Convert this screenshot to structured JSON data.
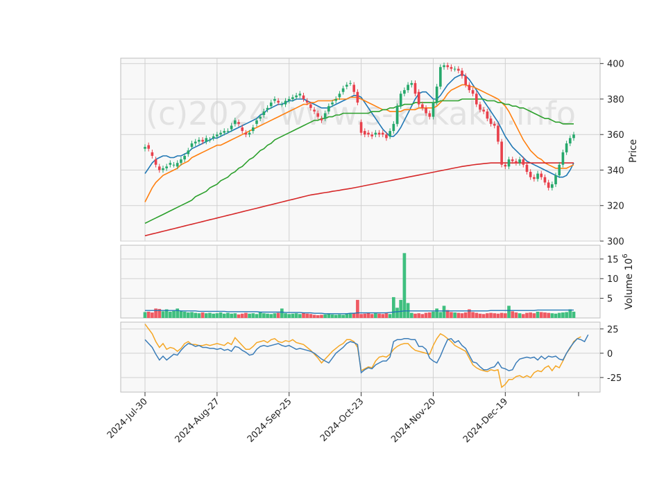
{
  "watermark": "(c)2024 www.s-kakaku.info",
  "chart_data": {
    "type": "candlestick",
    "dates": [
      "2024-Jul-30",
      "2024-Aug-27",
      "2024-Sep-25",
      "2024-Oct-23",
      "2024-Nov-20",
      "2024-Dec-19"
    ],
    "date_tick_index": [
      0,
      20,
      40,
      60,
      80,
      100
    ],
    "last_index": 119,
    "colors": {
      "up": "#26a86b",
      "down": "#e8404b",
      "up_vol": "#3fbf7f",
      "down_vol": "#ef5a63",
      "ma_blue": "#1f77b4",
      "ma_orange": "#ff7f0e",
      "ma_green": "#2ca02c",
      "ma_red": "#d62728",
      "osc_blue": "#3a7cb8",
      "osc_orange": "#f5a623"
    },
    "price_panel": {
      "ylabel": "Price",
      "ylim": [
        300,
        403
      ],
      "yticks": [
        300,
        320,
        340,
        360,
        380,
        400
      ],
      "close": [
        353,
        352,
        348,
        343,
        340,
        341,
        342,
        344,
        343,
        344,
        346,
        348,
        351,
        355,
        356,
        357,
        356,
        358,
        357,
        359,
        360,
        361,
        362,
        362,
        365,
        368,
        366,
        362,
        360,
        361,
        364,
        368,
        370,
        373,
        375,
        378,
        380,
        378,
        377,
        379,
        380,
        381,
        382,
        383,
        380,
        378,
        375,
        373,
        370,
        368,
        372,
        376,
        378,
        380,
        383,
        386,
        388,
        389,
        384,
        378,
        361,
        360,
        360,
        359,
        361,
        360,
        360,
        358,
        362,
        366,
        376,
        383,
        385,
        388,
        389,
        383,
        377,
        375,
        372,
        370,
        378,
        387,
        398,
        399,
        398,
        397,
        397,
        396,
        393,
        388,
        385,
        383,
        377,
        374,
        373,
        369,
        366,
        365,
        356,
        343,
        342,
        346,
        345,
        344,
        346,
        343,
        339,
        336,
        335,
        338,
        336,
        333,
        330,
        332,
        337,
        343,
        350,
        355,
        358,
        360
      ],
      "open": [
        352,
        354,
        350,
        346,
        342,
        340,
        341,
        343,
        343,
        342,
        344,
        346,
        349,
        353,
        355,
        356,
        357,
        356,
        357,
        358,
        359,
        360,
        361,
        362,
        363,
        366,
        367,
        364,
        361,
        360,
        362,
        366,
        369,
        371,
        374,
        376,
        379,
        379,
        377,
        377,
        379,
        380,
        381,
        382,
        382,
        379,
        377,
        374,
        372,
        369,
        369,
        373,
        377,
        379,
        381,
        384,
        387,
        389,
        388,
        384,
        367,
        362,
        361,
        360,
        360,
        361,
        361,
        360,
        359,
        362,
        366,
        376,
        383,
        385,
        388,
        389,
        384,
        377,
        375,
        372,
        370,
        378,
        387,
        398,
        399,
        398,
        397,
        397,
        396,
        393,
        388,
        385,
        383,
        377,
        374,
        373,
        369,
        366,
        365,
        356,
        343,
        342,
        346,
        345,
        344,
        346,
        343,
        339,
        336,
        335,
        338,
        336,
        333,
        330,
        332,
        337,
        343,
        350,
        355,
        358
      ],
      "ma": [
        {
          "key": "ma_blue",
          "values": [
            338,
            341,
            344,
            346,
            347,
            348,
            348,
            347,
            347,
            348,
            348,
            349,
            350,
            352,
            353,
            354,
            355,
            356,
            357,
            358,
            358,
            359,
            360,
            361,
            362,
            363,
            364,
            365,
            366,
            367,
            368,
            369,
            371,
            372,
            374,
            375,
            376,
            377,
            377,
            378,
            379,
            379,
            380,
            380,
            380,
            379,
            378,
            377,
            376,
            375,
            375,
            375,
            376,
            377,
            378,
            379,
            380,
            381,
            382,
            382,
            381,
            378,
            375,
            372,
            369,
            366,
            363,
            361,
            359,
            359,
            361,
            364,
            368,
            372,
            376,
            380,
            383,
            384,
            384,
            382,
            380,
            380,
            382,
            385,
            388,
            390,
            392,
            393,
            394,
            393,
            391,
            388,
            385,
            382,
            379,
            376,
            373,
            370,
            367,
            363,
            359,
            356,
            353,
            351,
            349,
            347,
            345,
            344,
            343,
            342,
            341,
            340,
            339,
            338,
            337,
            336,
            336,
            337,
            340,
            344
          ]
        },
        {
          "key": "ma_orange",
          "values": [
            322,
            326,
            330,
            333,
            335,
            337,
            338,
            339,
            340,
            341,
            343,
            344,
            345,
            347,
            348,
            349,
            350,
            351,
            352,
            353,
            354,
            354,
            355,
            356,
            357,
            358,
            359,
            360,
            361,
            362,
            363,
            364,
            365,
            366,
            367,
            368,
            369,
            370,
            371,
            372,
            373,
            374,
            375,
            376,
            377,
            377,
            378,
            378,
            379,
            379,
            379,
            379,
            379,
            380,
            380,
            380,
            380,
            381,
            381,
            381,
            380,
            379,
            378,
            377,
            376,
            375,
            374,
            374,
            373,
            373,
            373,
            373,
            374,
            374,
            374,
            374,
            375,
            375,
            375,
            375,
            375,
            376,
            378,
            380,
            383,
            385,
            386,
            387,
            388,
            388,
            387,
            387,
            386,
            385,
            384,
            383,
            382,
            381,
            380,
            378,
            376,
            373,
            369,
            365,
            361,
            357,
            354,
            351,
            349,
            347,
            346,
            344,
            343,
            342,
            341,
            341,
            341,
            341,
            342,
            343
          ]
        },
        {
          "key": "ma_green",
          "values": [
            310,
            311,
            312,
            313,
            314,
            315,
            316,
            317,
            318,
            319,
            320,
            321,
            322,
            323,
            325,
            326,
            327,
            328,
            330,
            331,
            332,
            334,
            335,
            336,
            338,
            339,
            341,
            342,
            344,
            346,
            347,
            349,
            351,
            352,
            354,
            355,
            357,
            358,
            359,
            360,
            361,
            362,
            363,
            364,
            365,
            366,
            367,
            368,
            368,
            369,
            369,
            370,
            370,
            371,
            371,
            372,
            372,
            372,
            372,
            372,
            372,
            372,
            372,
            373,
            373,
            373,
            374,
            374,
            375,
            375,
            376,
            376,
            377,
            377,
            377,
            378,
            378,
            378,
            378,
            378,
            378,
            378,
            379,
            379,
            379,
            379,
            379,
            379,
            380,
            380,
            380,
            380,
            380,
            380,
            380,
            379,
            379,
            379,
            378,
            378,
            377,
            377,
            376,
            376,
            375,
            375,
            374,
            373,
            372,
            371,
            370,
            369,
            369,
            368,
            367,
            367,
            366,
            366,
            366,
            366
          ]
        },
        {
          "key": "ma_red",
          "values": [
            303,
            303.5,
            304,
            304.5,
            305,
            305.5,
            306,
            306.5,
            307,
            307.5,
            308,
            308.5,
            309,
            309.5,
            310,
            310.5,
            311,
            311.5,
            312,
            312.5,
            313,
            313.5,
            314,
            314.5,
            315,
            315.5,
            316,
            316.5,
            317,
            317.5,
            318,
            318.5,
            319,
            319.5,
            320,
            320.5,
            321,
            321.5,
            322,
            322.5,
            323,
            323.5,
            324,
            324.5,
            325,
            325.5,
            326,
            326.3,
            326.6,
            327,
            327.3,
            327.6,
            328,
            328.3,
            328.6,
            329,
            329.3,
            329.6,
            330,
            330.4,
            330.8,
            331.2,
            331.6,
            332,
            332.4,
            332.8,
            333.2,
            333.6,
            334,
            334.4,
            334.8,
            335.2,
            335.6,
            336,
            336.4,
            336.8,
            337.2,
            337.6,
            338,
            338.4,
            338.8,
            339.2,
            339.6,
            340,
            340.4,
            340.8,
            341.2,
            341.6,
            342,
            342.3,
            342.6,
            342.9,
            343.2,
            343.4,
            343.6,
            343.8,
            344,
            344,
            344,
            344,
            344,
            344,
            344,
            344,
            344,
            344,
            344,
            344,
            344,
            344,
            344,
            344,
            344,
            344,
            344,
            344,
            344,
            344,
            344,
            344
          ]
        }
      ]
    },
    "volume_panel": {
      "ylabel": "Volume  10",
      "ylabel_exp": "6",
      "ylim": [
        0,
        18.5
      ],
      "yticks": [
        5,
        10,
        15
      ],
      "volume": [
        1.5,
        1.6,
        1.4,
        2.4,
        2.3,
        1.7,
        2.2,
        1.6,
        1.8,
        2.4,
        1.7,
        1.6,
        1.4,
        1.5,
        1.3,
        1.2,
        1.4,
        1.2,
        1.3,
        1.1,
        1.2,
        1.4,
        1.1,
        1.3,
        1.1,
        1.2,
        0.9,
        1.1,
        1.3,
        1.1,
        1.2,
        1.0,
        1.5,
        1.2,
        1.1,
        1.0,
        1.2,
        1.3,
        2.4,
        1.2,
        1.0,
        1.1,
        1.2,
        1.0,
        1.3,
        1.1,
        1.0,
        0.8,
        0.7,
        0.8,
        0.9,
        1.0,
        0.9,
        0.8,
        0.9,
        0.8,
        1.0,
        1.1,
        1.2,
        4.6,
        1.0,
        1.1,
        1.3,
        1.0,
        1.2,
        1.1,
        1.0,
        1.2,
        1.0,
        5.3,
        2.6,
        4.6,
        16.5,
        3.8,
        1.3,
        1.1,
        1.2,
        1.0,
        1.3,
        1.4,
        1.6,
        2.4,
        1.5,
        3.1,
        2.0,
        1.5,
        1.4,
        1.3,
        1.2,
        1.4,
        2.2,
        1.5,
        1.3,
        1.1,
        1.0,
        1.2,
        1.3,
        1.2,
        1.1,
        1.3,
        1.2,
        3.1,
        1.7,
        1.4,
        1.2,
        1.0,
        1.3,
        1.4,
        1.2,
        1.6,
        1.5,
        1.4,
        1.3,
        1.2,
        1.1,
        1.3,
        1.4,
        1.5,
        2.2,
        1.6
      ],
      "vol_ma": [
        1.9,
        1.9,
        1.9,
        1.9,
        1.9,
        1.9,
        1.9,
        1.9,
        1.9,
        1.9,
        1.8,
        1.8,
        1.8,
        1.8,
        1.8,
        1.7,
        1.7,
        1.7,
        1.7,
        1.7,
        1.7,
        1.7,
        1.7,
        1.6,
        1.6,
        1.6,
        1.6,
        1.6,
        1.6,
        1.6,
        1.6,
        1.6,
        1.5,
        1.5,
        1.5,
        1.5,
        1.5,
        1.5,
        1.5,
        1.4,
        1.4,
        1.4,
        1.4,
        1.4,
        1.3,
        1.3,
        1.3,
        1.2,
        1.2,
        1.2,
        1.1,
        1.1,
        1.1,
        1.1,
        1.1,
        1.1,
        1.1,
        1.2,
        1.2,
        1.3,
        1.3,
        1.3,
        1.3,
        1.3,
        1.3,
        1.3,
        1.3,
        1.3,
        1.4,
        1.5,
        1.6,
        1.7,
        1.8,
        1.8,
        1.8,
        1.8,
        1.8,
        1.8,
        1.8,
        1.8,
        1.8,
        1.8,
        1.8,
        1.8,
        1.8,
        1.8,
        1.8,
        1.8,
        1.8,
        1.8,
        1.8,
        1.8,
        1.8,
        1.8,
        1.8,
        1.8,
        1.9,
        1.9,
        1.9,
        1.9,
        1.9,
        1.9,
        1.9,
        1.9,
        1.9,
        1.9,
        1.9,
        1.9,
        1.9,
        2.0,
        2.0,
        2.0,
        2.0,
        2.0,
        2.0,
        2.0,
        2.0,
        2.0,
        2.0,
        2.0
      ]
    },
    "oscillator_panel": {
      "ylim": [
        -40,
        32
      ],
      "yticks": [
        -25,
        0,
        25
      ],
      "blue": [
        14,
        10,
        6,
        -1,
        -7,
        -3,
        -7,
        -4,
        -1,
        -2,
        3,
        7,
        10,
        9,
        7,
        8,
        6,
        6,
        5,
        5,
        4,
        5,
        3,
        4,
        2,
        7,
        6,
        3,
        1,
        -2,
        -1,
        4,
        7,
        8,
        7,
        8,
        9,
        10,
        8,
        7,
        8,
        6,
        4,
        5,
        4,
        3,
        2,
        0,
        -3,
        -6,
        -8,
        -10,
        -5,
        0,
        3,
        6,
        10,
        12,
        11,
        9,
        -20,
        -17,
        -15,
        -16,
        -12,
        -10,
        -8,
        -8,
        -4,
        12,
        14,
        14,
        15,
        15,
        14,
        14,
        7,
        7,
        4,
        -5,
        -8,
        -10,
        -3,
        6,
        14,
        15,
        11,
        13,
        8,
        5,
        -2,
        -9,
        -10,
        -14,
        -17,
        -17,
        -15,
        -14,
        -9,
        -15,
        -16,
        -18,
        -17,
        -10,
        -6,
        -5,
        -4,
        -5,
        -4,
        -7,
        -3,
        -6,
        -3,
        -4,
        -3,
        -6,
        -7,
        0,
        6,
        11,
        15,
        14,
        12,
        19
      ],
      "orange": [
        30,
        25,
        20,
        12,
        6,
        10,
        4,
        6,
        5,
        2,
        5,
        10,
        12,
        9,
        9,
        8,
        8,
        9,
        8,
        9,
        10,
        9,
        8,
        11,
        9,
        16,
        12,
        8,
        4,
        4,
        7,
        11,
        12,
        13,
        11,
        14,
        15,
        12,
        11,
        13,
        12,
        14,
        11,
        10,
        9,
        6,
        3,
        -1,
        -5,
        -10,
        -6,
        -2,
        2,
        5,
        8,
        10,
        14,
        14,
        12,
        6,
        -18,
        -16,
        -14,
        -15,
        -8,
        -4,
        -3,
        -4,
        -1,
        4,
        7,
        9,
        10,
        10,
        6,
        3,
        2,
        1,
        0,
        -1,
        8,
        15,
        20,
        18,
        15,
        12,
        8,
        6,
        4,
        2,
        -5,
        -12,
        -15,
        -17,
        -18,
        -19,
        -17,
        -18,
        -17,
        -35,
        -32,
        -27,
        -27,
        -24,
        -23,
        -25,
        -23,
        -25,
        -20,
        -18,
        -19,
        -15,
        -13,
        -18,
        -13,
        -15,
        -8,
        0,
        5,
        12,
        15,
        17
      ]
    }
  }
}
